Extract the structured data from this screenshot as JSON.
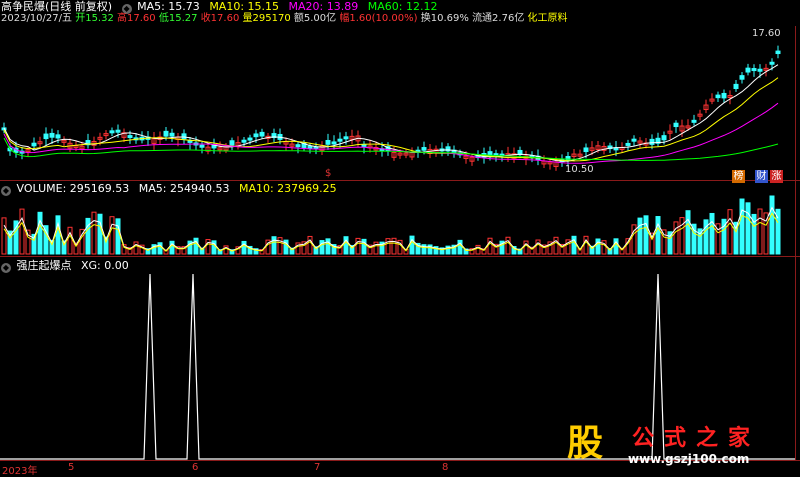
{
  "header": {
    "name": "高争民爆",
    "mode": "(日线 前复权)",
    "ma5": "MA5: 15.73",
    "ma10": "MA10: 15.15",
    "ma20": "MA20: 13.89",
    "ma60": "MA60: 12.12"
  },
  "quote": {
    "date": "2023/10/27/五",
    "open": "开15.32",
    "high": "高17.60",
    "low": "低15.27",
    "close": "收17.60",
    "volume": "量295170",
    "amount": "额5.00亿",
    "change": "幅1.60(10.00%)",
    "turnover": "换10.69%",
    "float": "流通2.76亿",
    "sector": "化工原料"
  },
  "price_labels": {
    "high": "17.60",
    "low": "10.50"
  },
  "volume_header": {
    "volume": "VOLUME: 295169.53",
    "ma5": "MA5: 254940.53",
    "ma10": "MA10: 237969.25"
  },
  "indicator_header": {
    "name": "强庄起爆点",
    "xg": "XG: 0.00"
  },
  "xaxis": {
    "year": "2023年",
    "months": [
      "5",
      "6",
      "7",
      "8"
    ]
  },
  "tags": [
    "榜",
    "财",
    "涨"
  ],
  "watermark": {
    "logo": "股",
    "title": "公式之家",
    "url": "www.gszj100.com"
  },
  "colors": {
    "up": "#ff3333",
    "down": "#33ffff",
    "ma5": "#ffffff",
    "ma10": "#ffff00",
    "ma20": "#ff00ff",
    "ma60": "#00ff00",
    "border": "#8a1a1a"
  }
}
